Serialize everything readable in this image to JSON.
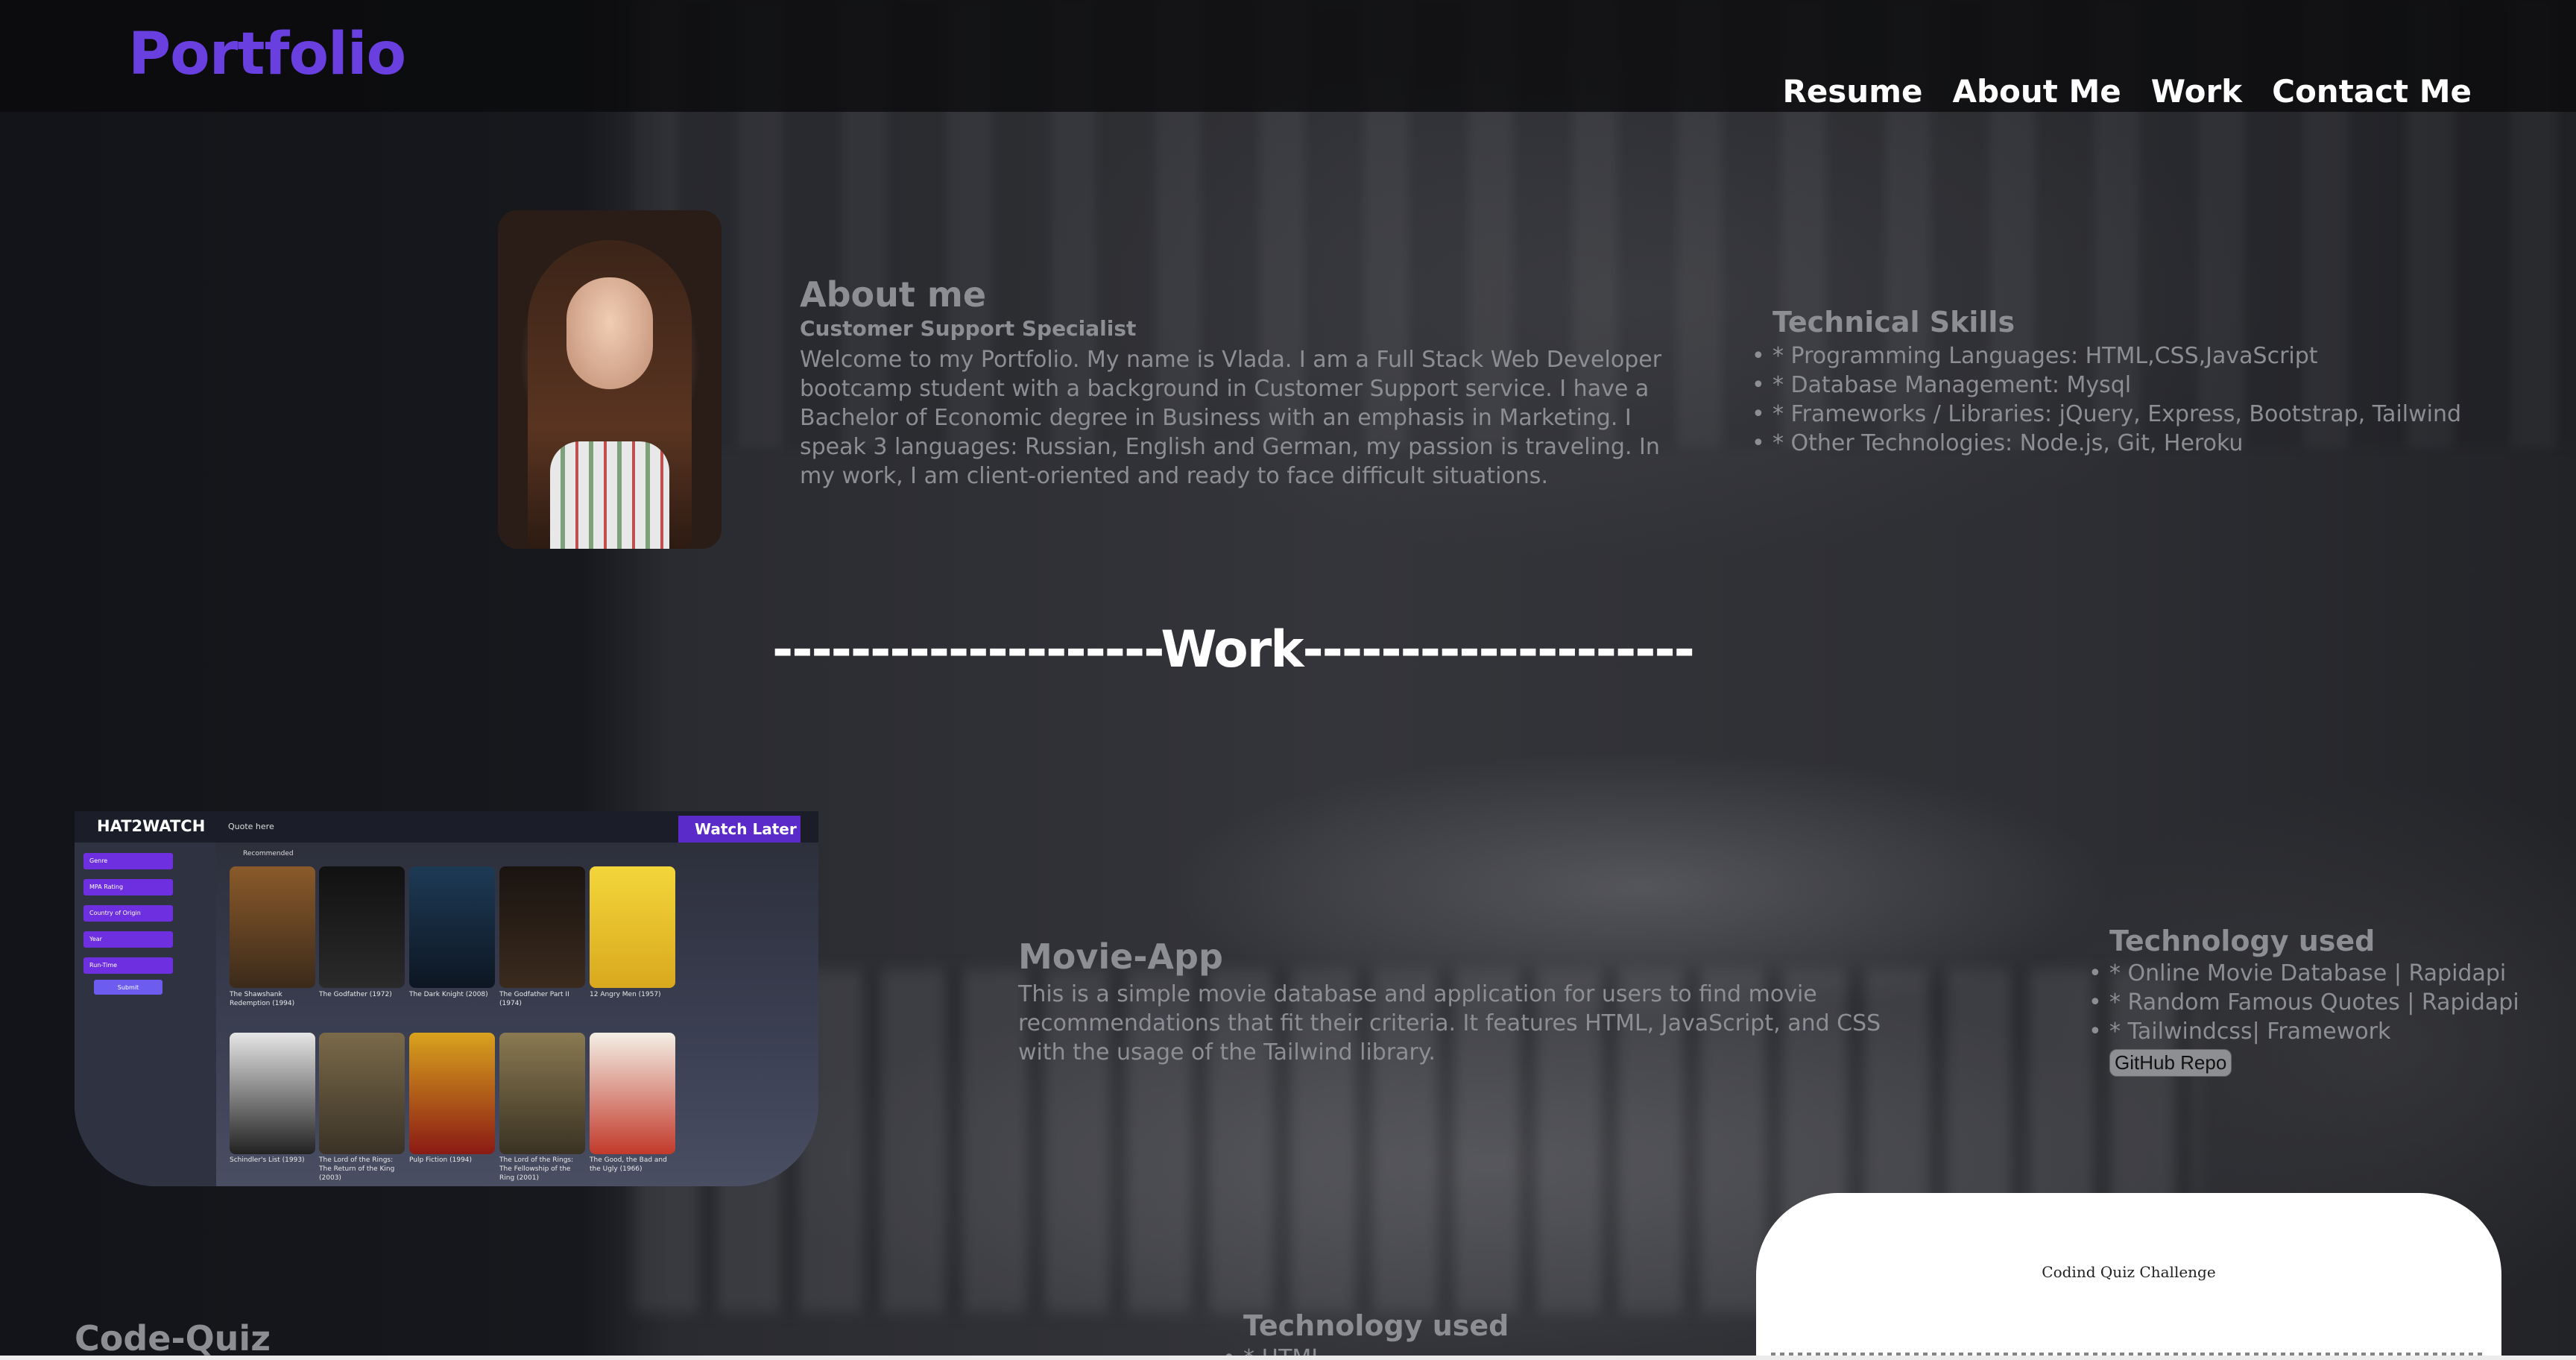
{
  "header": {
    "brand": "Portfolio",
    "nav": [
      "Resume",
      "About Me",
      "Work",
      "Contact Me"
    ]
  },
  "about": {
    "title": "About me",
    "role": "Customer Support Specialist",
    "text": "Welcome to my Portfolio. My name is Vlada. I am a Full Stack Web Developer bootcamp student with a background in Customer Support service. I have a Bachelor of Economic degree in Business with an emphasis in Marketing. I speak 3 languages: Russian, English and German, my passion is traveling. In my work, I am client-oriented and ready to face difficult situations."
  },
  "skills": {
    "title": "Technical Skills",
    "items": [
      "* Programming Languages: HTML,CSS,JavaScript",
      "* Database Management: Mysql",
      "* Frameworks / Libraries: jQuery, Express, Bootstrap, Tailwind",
      "* Other Technologies: Node.js, Git, Heroku"
    ]
  },
  "work": {
    "heading": "--------------------Work--------------------"
  },
  "movie_app": {
    "title": "Movie-App",
    "description": "This is a simple movie database and application for users to find movie recommendations that fit their criteria. It features HTML, JavaScript, and CSS with the usage of the Tailwind library.",
    "tech_title": "Technology used",
    "tech": [
      "* Online Movie Database | Rapidapi",
      "* Random Famous Quotes | Rapidapi",
      "* Tailwindcss| Framework"
    ],
    "repo_label": "GitHub Repo",
    "screenshot": {
      "logo": "HAT2WATCH",
      "quote": "Quote here",
      "watch_later": "Watch Later",
      "recommended": "Recommended",
      "filters": [
        "Genre",
        "MPA Rating",
        "Country of Origin",
        "Year",
        "Run-Time"
      ],
      "submit": "Submit",
      "movies": [
        "The Shawshank Redemption (1994)",
        "The Godfather (1972)",
        "The Dark Knight (2008)",
        "The Godfather Part II (1974)",
        "12 Angry Men (1957)",
        "Schindler's List (1993)",
        "The Lord of the Rings: The Return of the King (2003)",
        "Pulp Fiction (1994)",
        "The Lord of the Rings: The Fellowship of the Ring (2001)",
        "The Good, the Bad and the Ugly (1966)"
      ]
    }
  },
  "code_quiz": {
    "title": "Code-Quiz",
    "preview_title": "Codind Quiz Challenge",
    "tech_title": "Technology used",
    "tech": [
      "* HTML"
    ]
  },
  "colors": {
    "brand": "#6a3fe0",
    "muted_text": "#8c8e94",
    "accent_purple": "#6d2fe0"
  }
}
